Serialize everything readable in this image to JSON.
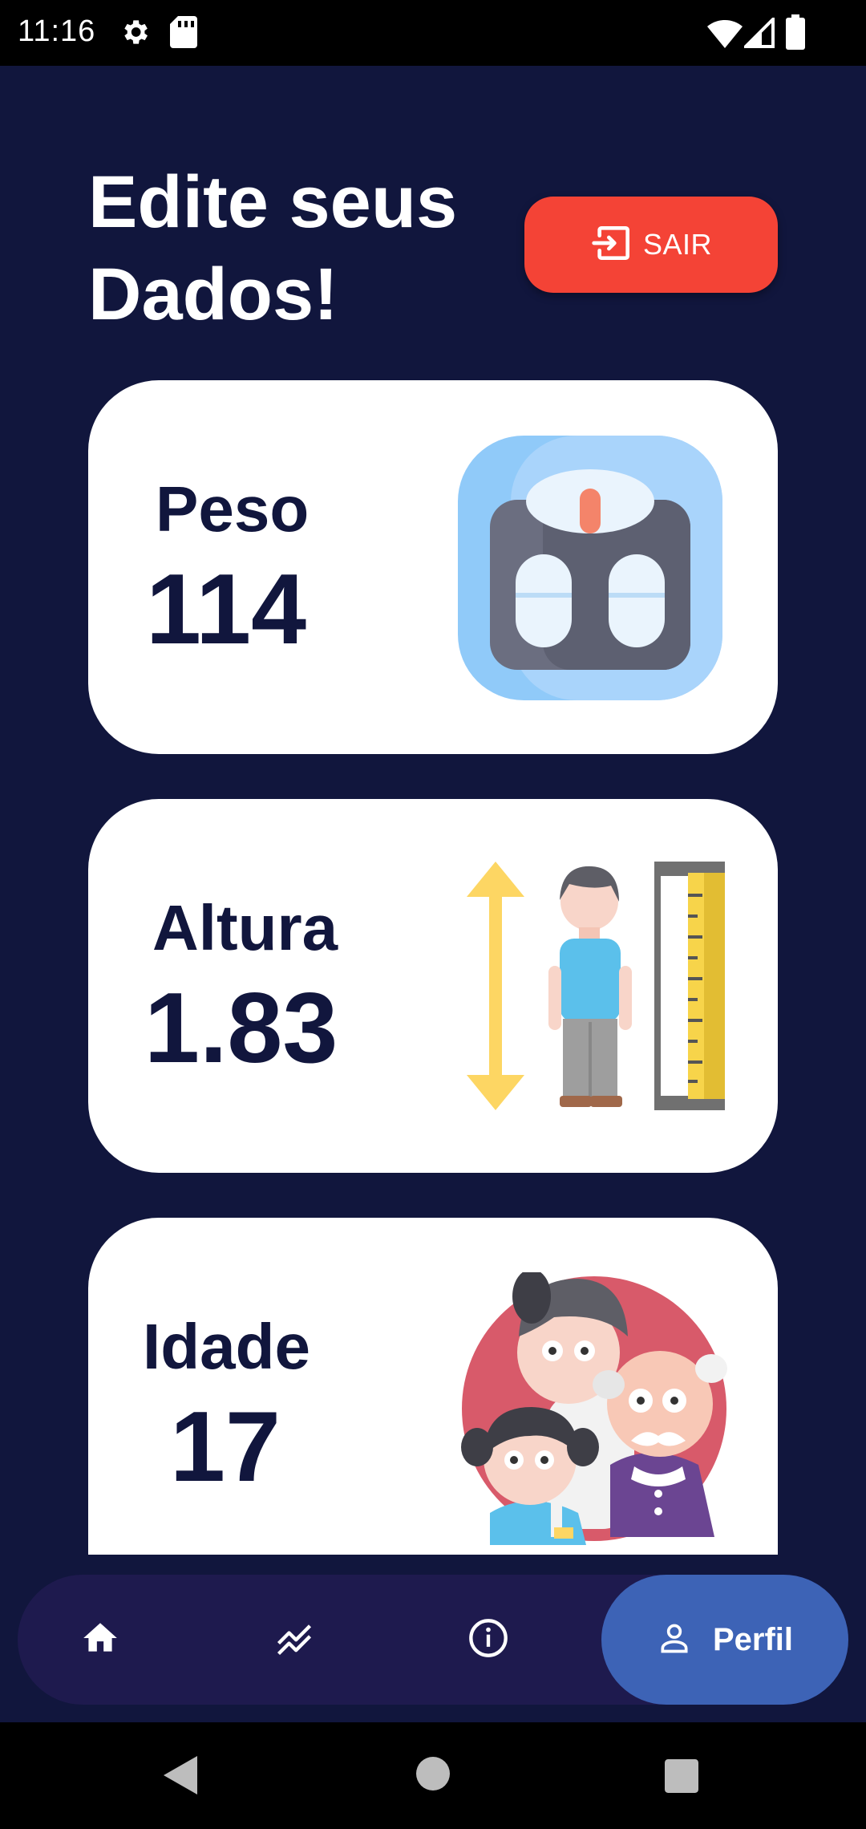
{
  "status_bar": {
    "time": "11:16",
    "icons": [
      "gear-icon",
      "sd-card-icon",
      "wifi-icon",
      "signal-icon",
      "battery-icon"
    ]
  },
  "header": {
    "title": "Edite seus\nDados!",
    "logout_label": "SAIR",
    "logout_icon": "logout-icon",
    "logout_color": "#f44336"
  },
  "cards": [
    {
      "label": "Peso",
      "value": "114",
      "illustration": "scale-illustration"
    },
    {
      "label": "Altura",
      "value": "1.83",
      "illustration": "height-measure-illustration"
    },
    {
      "label": "Idade",
      "value": "17",
      "illustration": "family-illustration"
    }
  ],
  "bottom_nav": {
    "items": [
      {
        "icon": "home-icon"
      },
      {
        "icon": "chart-icon"
      },
      {
        "icon": "info-icon"
      },
      {
        "icon": "person-icon",
        "label": "Perfil",
        "active": true
      }
    ],
    "active_color": "#3d63b6"
  },
  "theme": {
    "background": "#11163d",
    "card_text": "#11163d"
  }
}
